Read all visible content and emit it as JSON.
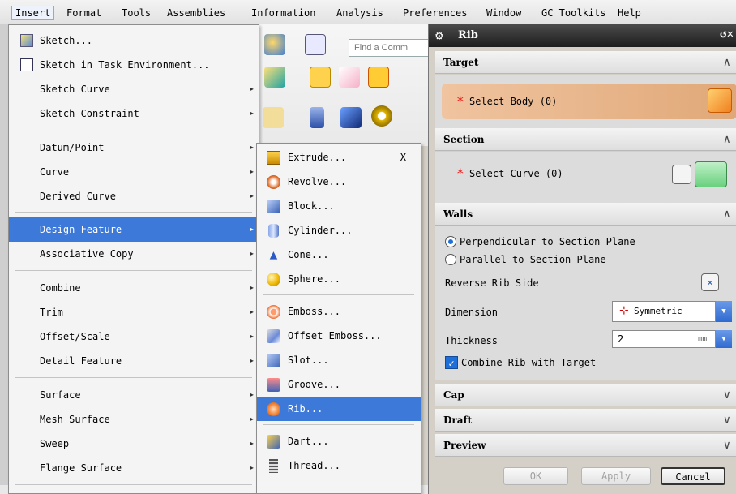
{
  "menubar": {
    "items": [
      {
        "label": "Insert"
      },
      {
        "label": "Format"
      },
      {
        "label": "Tools"
      },
      {
        "label": "Assemblies"
      },
      {
        "label": "Information"
      },
      {
        "label": "Analysis"
      },
      {
        "label": "Preferences"
      },
      {
        "label": "Window"
      },
      {
        "label": "GC Toolkits"
      },
      {
        "label": "Help"
      }
    ]
  },
  "search": {
    "placeholder": "Find a Comm"
  },
  "insert_menu": {
    "items": [
      {
        "label": "Sketch...",
        "has_submenu": false
      },
      {
        "label": "Sketch in Task Environment...",
        "has_submenu": false
      },
      {
        "label": "Sketch Curve",
        "has_submenu": true
      },
      {
        "label": "Sketch Constraint",
        "has_submenu": true
      },
      {
        "label": "Datum/Point",
        "has_submenu": true
      },
      {
        "label": "Curve",
        "has_submenu": true
      },
      {
        "label": "Derived Curve",
        "has_submenu": true
      },
      {
        "label": "Design Feature",
        "has_submenu": true,
        "highlighted": true
      },
      {
        "label": "Associative Copy",
        "has_submenu": true
      },
      {
        "label": "Combine",
        "has_submenu": true
      },
      {
        "label": "Trim",
        "has_submenu": true
      },
      {
        "label": "Offset/Scale",
        "has_submenu": true
      },
      {
        "label": "Detail Feature",
        "has_submenu": true
      },
      {
        "label": "Surface",
        "has_submenu": true
      },
      {
        "label": "Mesh Surface",
        "has_submenu": true
      },
      {
        "label": "Sweep",
        "has_submenu": true
      },
      {
        "label": "Flange Surface",
        "has_submenu": true
      }
    ]
  },
  "design_submenu": {
    "items": [
      {
        "label": "Extrude...",
        "shortcut": "X",
        "icon": "extrude-icon"
      },
      {
        "label": "Revolve...",
        "icon": "revolve-icon"
      },
      {
        "label": "Block...",
        "icon": "block-icon"
      },
      {
        "label": "Cylinder...",
        "icon": "cylinder-icon"
      },
      {
        "label": "Cone...",
        "icon": "cone-icon"
      },
      {
        "label": "Sphere...",
        "icon": "sphere-icon"
      },
      {
        "label": "Emboss...",
        "icon": "emboss-icon"
      },
      {
        "label": "Offset Emboss...",
        "icon": "offset-emboss-icon"
      },
      {
        "label": "Slot...",
        "icon": "slot-icon"
      },
      {
        "label": "Groove...",
        "icon": "groove-icon"
      },
      {
        "label": "Rib...",
        "icon": "rib-icon",
        "highlighted": true
      },
      {
        "label": "Dart...",
        "icon": "dart-icon"
      },
      {
        "label": "Thread...",
        "icon": "thread-icon"
      }
    ]
  },
  "rib_dialog": {
    "title": "Rib",
    "sections": {
      "target": {
        "title": "Target",
        "select_label": "Select Body (0)"
      },
      "section": {
        "title": "Section",
        "select_label": "Select Curve (0)"
      },
      "walls": {
        "title": "Walls",
        "option_perpendicular": "Perpendicular to Section Plane",
        "option_parallel": "Parallel to Section Plane",
        "reverse_label": "Reverse Rib Side",
        "dimension_label": "Dimension",
        "dimension_value": "Symmetric",
        "thickness_label": "Thickness",
        "thickness_value": "2",
        "thickness_unit": "mm",
        "combine_label": "Combine Rib with Target"
      },
      "cap": {
        "title": "Cap"
      },
      "draft": {
        "title": "Draft"
      },
      "preview": {
        "title": "Preview"
      }
    },
    "buttons": {
      "ok": "OK",
      "apply": "Apply",
      "cancel": "Cancel"
    }
  },
  "colors": {
    "highlight": "#3d79d8",
    "target_row": "#e4b088",
    "dialog_title": "#2b2b2b"
  }
}
